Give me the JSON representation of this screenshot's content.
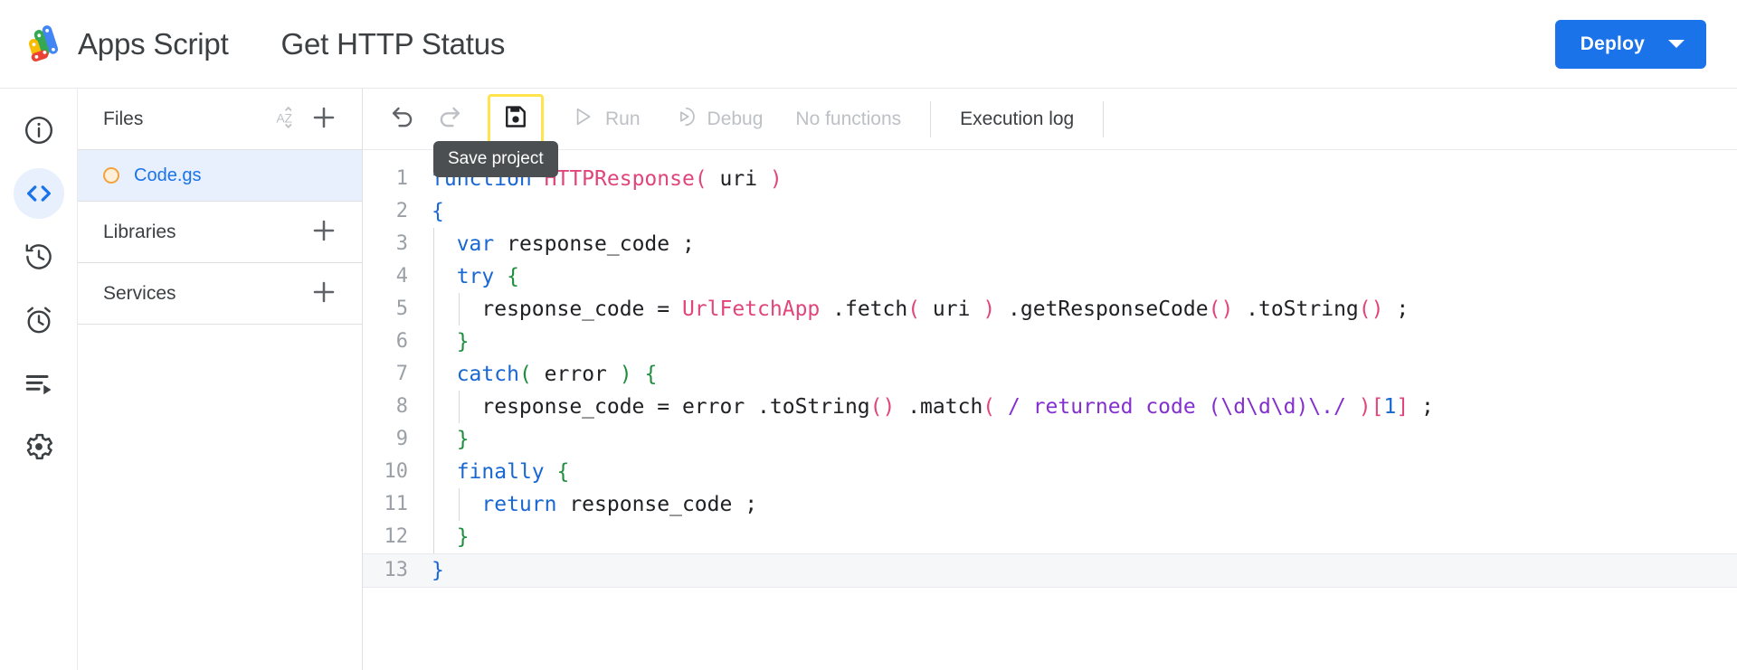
{
  "header": {
    "brand_name": "Apps Script",
    "logo_icon": "apps-script-logo",
    "project_title": "Get HTTP Status",
    "deploy_label": "Deploy",
    "deploy_caret_icon": "chevron-down-icon",
    "deploy_color": "#1a73e8"
  },
  "rail": {
    "items": [
      {
        "icon": "info-icon",
        "name": "overview",
        "active": false
      },
      {
        "icon": "code-icon",
        "name": "editor",
        "active": true
      },
      {
        "icon": "history-icon",
        "name": "versions",
        "active": false
      },
      {
        "icon": "alarm-icon",
        "name": "triggers",
        "active": false
      },
      {
        "icon": "executions-icon",
        "name": "executions",
        "active": false
      },
      {
        "icon": "gear-icon",
        "name": "settings",
        "active": false
      }
    ]
  },
  "files_panel": {
    "files_header": "Files",
    "sort_icon": "sort-az-icon",
    "add_file_icon": "plus-icon",
    "file": {
      "name": "Code.gs",
      "status_icon": "unsaved-dot-icon",
      "selected": true
    },
    "libraries_header": "Libraries",
    "libraries_add_icon": "plus-icon",
    "services_header": "Services",
    "services_add_icon": "plus-icon"
  },
  "toolbar": {
    "undo_icon": "undo-icon",
    "redo_icon": "redo-icon",
    "save_icon": "save-icon",
    "save_tooltip": "Save project",
    "run_label": "Run",
    "run_icon": "play-icon",
    "debug_label": "Debug",
    "debug_icon": "debug-icon",
    "functions_label": "No functions",
    "execution_log_label": "Execution log",
    "focus_ring_color": "#ffe44d"
  },
  "editor": {
    "lines": [
      {
        "n": "1",
        "active": false
      },
      {
        "n": "2",
        "active": false
      },
      {
        "n": "3",
        "active": false
      },
      {
        "n": "4",
        "active": false
      },
      {
        "n": "5",
        "active": false
      },
      {
        "n": "6",
        "active": false
      },
      {
        "n": "7",
        "active": false
      },
      {
        "n": "8",
        "active": false
      },
      {
        "n": "9",
        "active": false
      },
      {
        "n": "10",
        "active": false
      },
      {
        "n": "11",
        "active": false
      },
      {
        "n": "12",
        "active": false
      },
      {
        "n": "13",
        "active": true
      }
    ],
    "code": {
      "l1_kw": "function",
      "l1_fn": "HTTPResponse",
      "l1_open": "(",
      "l1_arg": " uri ",
      "l1_close": ")",
      "l2_brace": "{",
      "l3_kw": "var",
      "l3_rest": " response_code ;",
      "l4_kw": "try",
      "l4_brace": "{",
      "l5_a": "response_code = ",
      "l5_cls": "UrlFetchApp",
      "l5_b": " .fetch",
      "l5_p1": "(",
      "l5_c": " uri ",
      "l5_p2": ")",
      "l5_d": " .getResponseCode",
      "l5_p3": "()",
      "l5_e": " .toString",
      "l5_p4": "()",
      "l5_f": " ;",
      "l6_brace": "}",
      "l7_kw": "catch",
      "l7_p1": "(",
      "l7_arg": " error ",
      "l7_p2": ")",
      "l7_brace": " {",
      "l8_a": "response_code = error .toString",
      "l8_p1": "()",
      "l8_b": " .match",
      "l8_p2": "(",
      "l8_re": " / returned code (\\d\\d\\d)\\./ ",
      "l8_p3": ")",
      "l8_br1": "[",
      "l8_num": "1",
      "l8_br2": "]",
      "l8_c": " ;",
      "l9_brace": "}",
      "l10_kw": "finally",
      "l10_brace": "{",
      "l11_kw": "return",
      "l11_rest": " response_code ;",
      "l12_brace": "}",
      "l13_brace": "}"
    }
  }
}
